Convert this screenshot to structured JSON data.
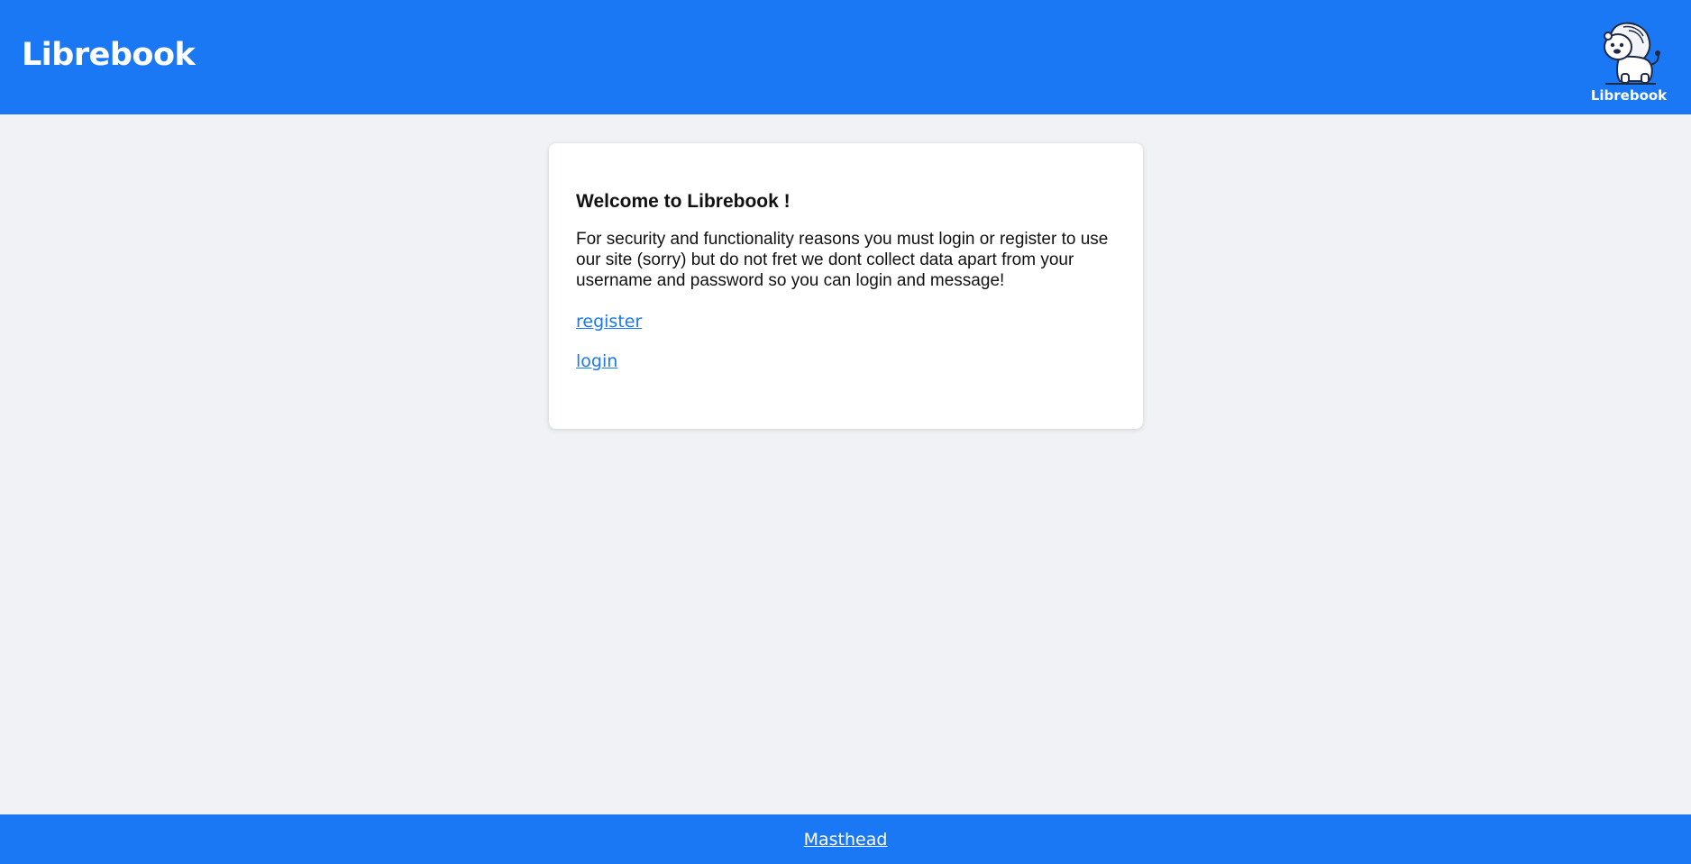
{
  "header": {
    "title": "Librebook",
    "logo": {
      "icon": "lion-mascot-icon",
      "text": "Librebook"
    },
    "background_color": "#1a78f5"
  },
  "welcome_card": {
    "heading": "Welcome to Librebook !",
    "message": "For security and functionality reasons you must login or register to use our site (sorry) but do not fret we dont collect data apart from your username and password so you can login and message!",
    "register_link": "register",
    "login_link": "login",
    "link_color": "#1a78f5"
  },
  "footer": {
    "link": "Masthead",
    "background_color": "#1a78f5"
  }
}
